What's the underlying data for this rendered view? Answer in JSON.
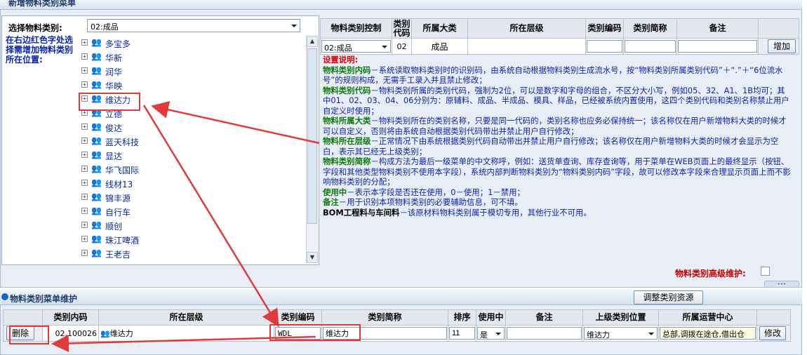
{
  "top_panel": {
    "title": "新增物料类别菜单"
  },
  "left_pane": {
    "select_label": "选择物料类别:",
    "select_value": "02:成品",
    "hint": "在右边红色字处选择需增加物料类别所在位置:",
    "tree_items": [
      {
        "label": "多宝多"
      },
      {
        "label": "华新"
      },
      {
        "label": "润华"
      },
      {
        "label": "华映"
      },
      {
        "label": "维达力"
      },
      {
        "label": "立德"
      },
      {
        "label": "俊达"
      },
      {
        "label": "蓝天科技"
      },
      {
        "label": "显达"
      },
      {
        "label": "华飞国际"
      },
      {
        "label": "线材13"
      },
      {
        "label": "锦丰源"
      },
      {
        "label": "自行车"
      },
      {
        "label": "顺创"
      },
      {
        "label": "珠江啤酒"
      },
      {
        "label": "王老吉"
      }
    ]
  },
  "add_table": {
    "headers": [
      "物料类别控制",
      "类别代码",
      "所属大类",
      "所在层级",
      "类别编码",
      "类别简称",
      "备注"
    ],
    "row": {
      "control": "02:成品",
      "code": "02",
      "major": "成品",
      "level": "",
      "cat_code": "",
      "short_name": "",
      "remark": ""
    },
    "add_button": "增加"
  },
  "notes": [
    {
      "key": "设置说明:",
      "body": "",
      "style": "title"
    },
    {
      "key": "物料类别内码",
      "body": "－系统读取物料类别时的识别码，由系统自动根据物料类别生成流水号，按“物料类别所属类别代码”＋“.”＋“6位流水号”的规则构成，无需手工录入并且禁止修改；"
    },
    {
      "key": "物料类别代码",
      "body": "－物料类别所属的类别代码，强制为2位，可以是数字和字母的组合，不区分大小写，例如05、32、A1、1B均可；其中01、02、03、04、06分别为：原辅料、成品、半成品、模具、样品，已经被系统内置使用，这四个类别代码和类别名称禁止用户自定义时使用；"
    },
    {
      "key": "物料所属大类",
      "body": "－物料类别所在的类别名称，只要是同一代码的，类别名称也应务必保持统一；该名称仅在用户新增物料大类的时候才可以自定义，否则将由系统自动根据类别代码带出并禁止用户自行修改；"
    },
    {
      "key": "物料所在层级",
      "body": "－正常情况下由系统根据类别代码自动带出并禁止用户自行修改；该名称仅在用户新增物料大类的时候才会显示为空白，表示其已经无上级类别；"
    },
    {
      "key": "物料类别简称",
      "body": "－构成方法为最后一级菜单的中文称呼，例如：送货单查询、库存查询等，用于菜单在WEB页面上的最终显示（按钮、字段和其他类型物料类别不使用本字段），系统内部判断物料类别为“物料类别内码”字段，故可以修改本字段来合理显示页面上而不影响物料类别的分配；"
    },
    {
      "key": "使用中",
      "body": "－表示本字段是否还在使用，0－使用；1－禁用；"
    },
    {
      "key": "备注",
      "body": "－用于识别本项物料类别的必要辅助信息，可不填。"
    },
    {
      "key": "BOM工程料与车间料",
      "body": "－该原材料物料类别属于模切专用，其他行业不可用。",
      "style": "black"
    }
  ],
  "advanced": {
    "label": "物料类别高级维护:"
  },
  "bottom_panel": {
    "title": "物料类别菜单维护",
    "adjust_button": "调整类别资源",
    "headers": [
      "",
      "类别内码",
      "所在层级",
      "类别编码",
      "类别简称",
      "排序",
      "使用中",
      "备注",
      "上级类别位置",
      "所属运营中心",
      ""
    ],
    "row": {
      "delete_button": "删除",
      "inner_code": "02.100026",
      "level": "维达力",
      "cat_code": "WDL",
      "short_name": "维达力",
      "sort": "11",
      "in_use": "是",
      "remark": "",
      "parent": "维达力",
      "ops_center": "总部,调拨在途仓,借出仓",
      "modify_button": "修改"
    }
  },
  "colors": {
    "hint": "#0b23b4",
    "annotation": "#e23a3a",
    "note_key": "#0b7a0b",
    "note_title": "#e00000"
  }
}
